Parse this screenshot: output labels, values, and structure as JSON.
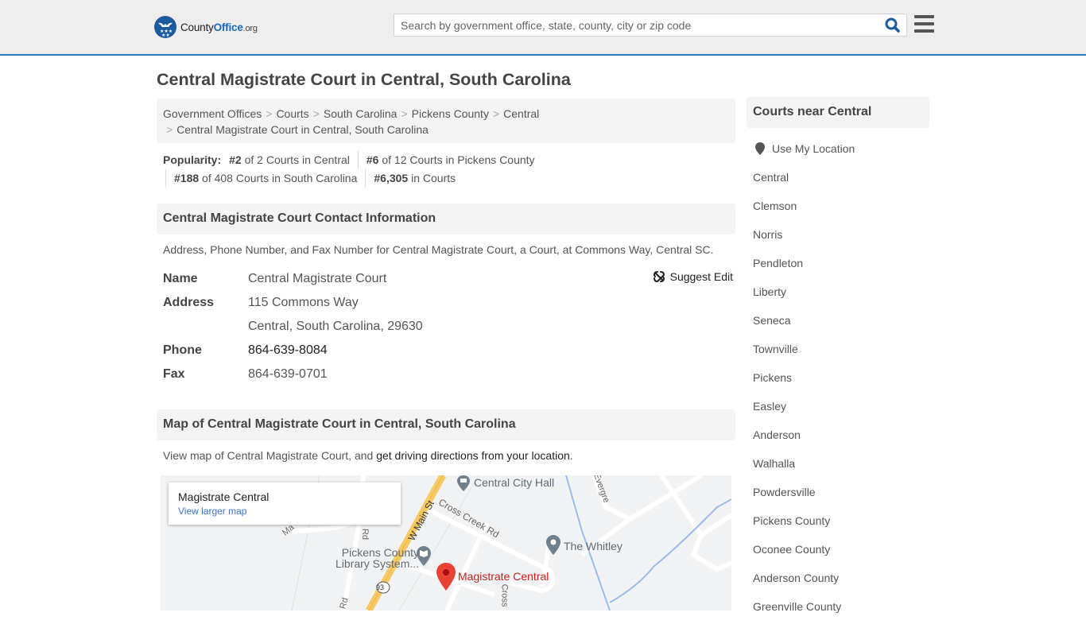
{
  "header": {
    "logo": {
      "part1": "County",
      "part2": "Office",
      "part3": ".org"
    },
    "search": {
      "placeholder": "Search by government office, state, county, city or zip code",
      "value": ""
    },
    "search_icon": "search-icon",
    "menu_icon": "hamburger-menu-icon"
  },
  "page": {
    "title": "Central Magistrate Court in Central, South Carolina",
    "breadcrumb": [
      {
        "label": "Government Offices"
      },
      {
        "label": "Courts"
      },
      {
        "label": "South Carolina"
      },
      {
        "label": "Pickens County"
      },
      {
        "label": "Central"
      },
      {
        "label": "Central Magistrate Court in Central, South Carolina"
      }
    ],
    "popularity": {
      "label": "Popularity:",
      "items": [
        {
          "rank": "#2",
          "text": " of 2 Courts in Central"
        },
        {
          "rank": "#6",
          "text": " of 12 Courts in Pickens County"
        },
        {
          "rank": "#188",
          "text": " of 408 Courts in South Carolina"
        },
        {
          "rank": "#6,305",
          "text": " in Courts"
        }
      ]
    }
  },
  "contact": {
    "heading": "Central Magistrate Court Contact Information",
    "description": "Address, Phone Number, and Fax Number for Central Magistrate Court, a Court, at Commons Way, Central SC.",
    "suggest_edit": "Suggest Edit",
    "fields": {
      "name_label": "Name",
      "name": "Central Magistrate Court",
      "address_label": "Address",
      "address_line1": "115 Commons Way",
      "address_line2": "Central, South Carolina, 29630",
      "phone_label": "Phone",
      "phone": "864-639-8084",
      "fax_label": "Fax",
      "fax": "864-639-0701"
    }
  },
  "map_section": {
    "heading": "Map of Central Magistrate Court in Central, South Carolina",
    "description_prefix": "View map of Central Magistrate Court, and ",
    "directions_link": "get driving directions from your location",
    "description_suffix": ".",
    "map": {
      "card_title": "Magistrate Central",
      "card_link": "View larger map",
      "places": {
        "city_hall": "Central City Hall",
        "whitley": "The Whitley",
        "library_line1": "Pickens County",
        "library_line2": "Library System...",
        "marker": "Magistrate Central"
      },
      "streets": {
        "main": "W Main St",
        "cross_creek": "Cross Creek Rd",
        "cross": "Cross",
        "evergreen": "Evergre",
        "rd1": "Rd",
        "rd2": "Rd",
        "ma": "Ma",
        "route": "93"
      }
    }
  },
  "sidebar": {
    "heading": "Courts near Central",
    "use_location": "Use My Location",
    "links": [
      "Central",
      "Clemson",
      "Norris",
      "Pendleton",
      "Liberty",
      "Seneca",
      "Townville",
      "Pickens",
      "Easley",
      "Anderson",
      "Walhalla",
      "Powdersville",
      "Pickens County",
      "Oconee County",
      "Anderson County",
      "Greenville County"
    ]
  }
}
